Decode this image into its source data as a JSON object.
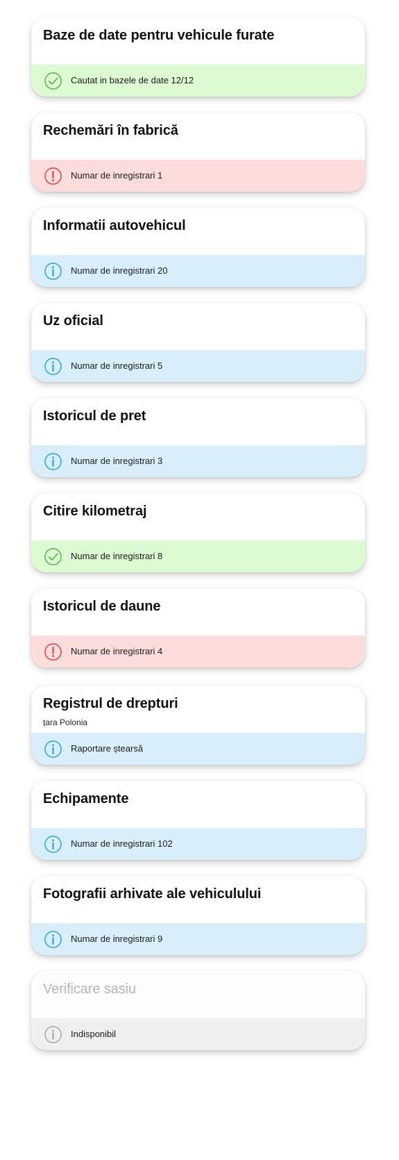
{
  "colors": {
    "ok_bg": "#dcfbd2",
    "ok_icon": "#5db558",
    "warn_bg": "#fddcdc",
    "warn_icon": "#e0474c",
    "info_bg": "#d8effb",
    "info_icon": "#37a6de",
    "na_bg": "#efefef",
    "na_icon": "#a9a9a9"
  },
  "cards": [
    {
      "title": "Baze de date pentru vehicule furate",
      "subtitle": "",
      "status": "ok",
      "status_icon": "check-circle-icon",
      "status_text": "Cautat in bazele de date 12/12"
    },
    {
      "title": "Rechemări în fabrică",
      "subtitle": "",
      "status": "warn",
      "status_icon": "exclamation-circle-icon",
      "status_text": "Numar de inregistrari 1"
    },
    {
      "title": "Informatii autovehicul",
      "subtitle": "",
      "status": "info",
      "status_icon": "info-circle-icon",
      "status_text": "Numar de inregistrari 20"
    },
    {
      "title": "Uz oficial",
      "subtitle": "",
      "status": "info",
      "status_icon": "info-circle-icon",
      "status_text": "Numar de inregistrari 5"
    },
    {
      "title": "Istoricul de pret",
      "subtitle": "",
      "status": "info",
      "status_icon": "info-circle-icon",
      "status_text": "Numar de inregistrari 3"
    },
    {
      "title": "Citire kilometraj",
      "subtitle": "",
      "status": "ok",
      "status_icon": "check-circle-icon",
      "status_text": "Numar de inregistrari 8"
    },
    {
      "title": "Istoricul de daune",
      "subtitle": "",
      "status": "warn",
      "status_icon": "exclamation-circle-icon",
      "status_text": "Numar de inregistrari 4"
    },
    {
      "title": "Registrul de drepturi",
      "subtitle": "țara Polonia",
      "status": "info",
      "status_icon": "info-circle-icon",
      "status_text": "Raportare ștearsă"
    },
    {
      "title": "Echipamente",
      "subtitle": "",
      "status": "info",
      "status_icon": "info-circle-icon",
      "status_text": "Numar de inregistrari 102"
    },
    {
      "title": "Fotografii arhivate ale vehiculului",
      "subtitle": "",
      "status": "info",
      "status_icon": "info-circle-icon",
      "status_text": "Numar de inregistrari 9"
    },
    {
      "title": "Verificare sasiu",
      "subtitle": "",
      "status": "na",
      "status_icon": "info-circle-icon",
      "status_text": "Indisponibil"
    }
  ]
}
